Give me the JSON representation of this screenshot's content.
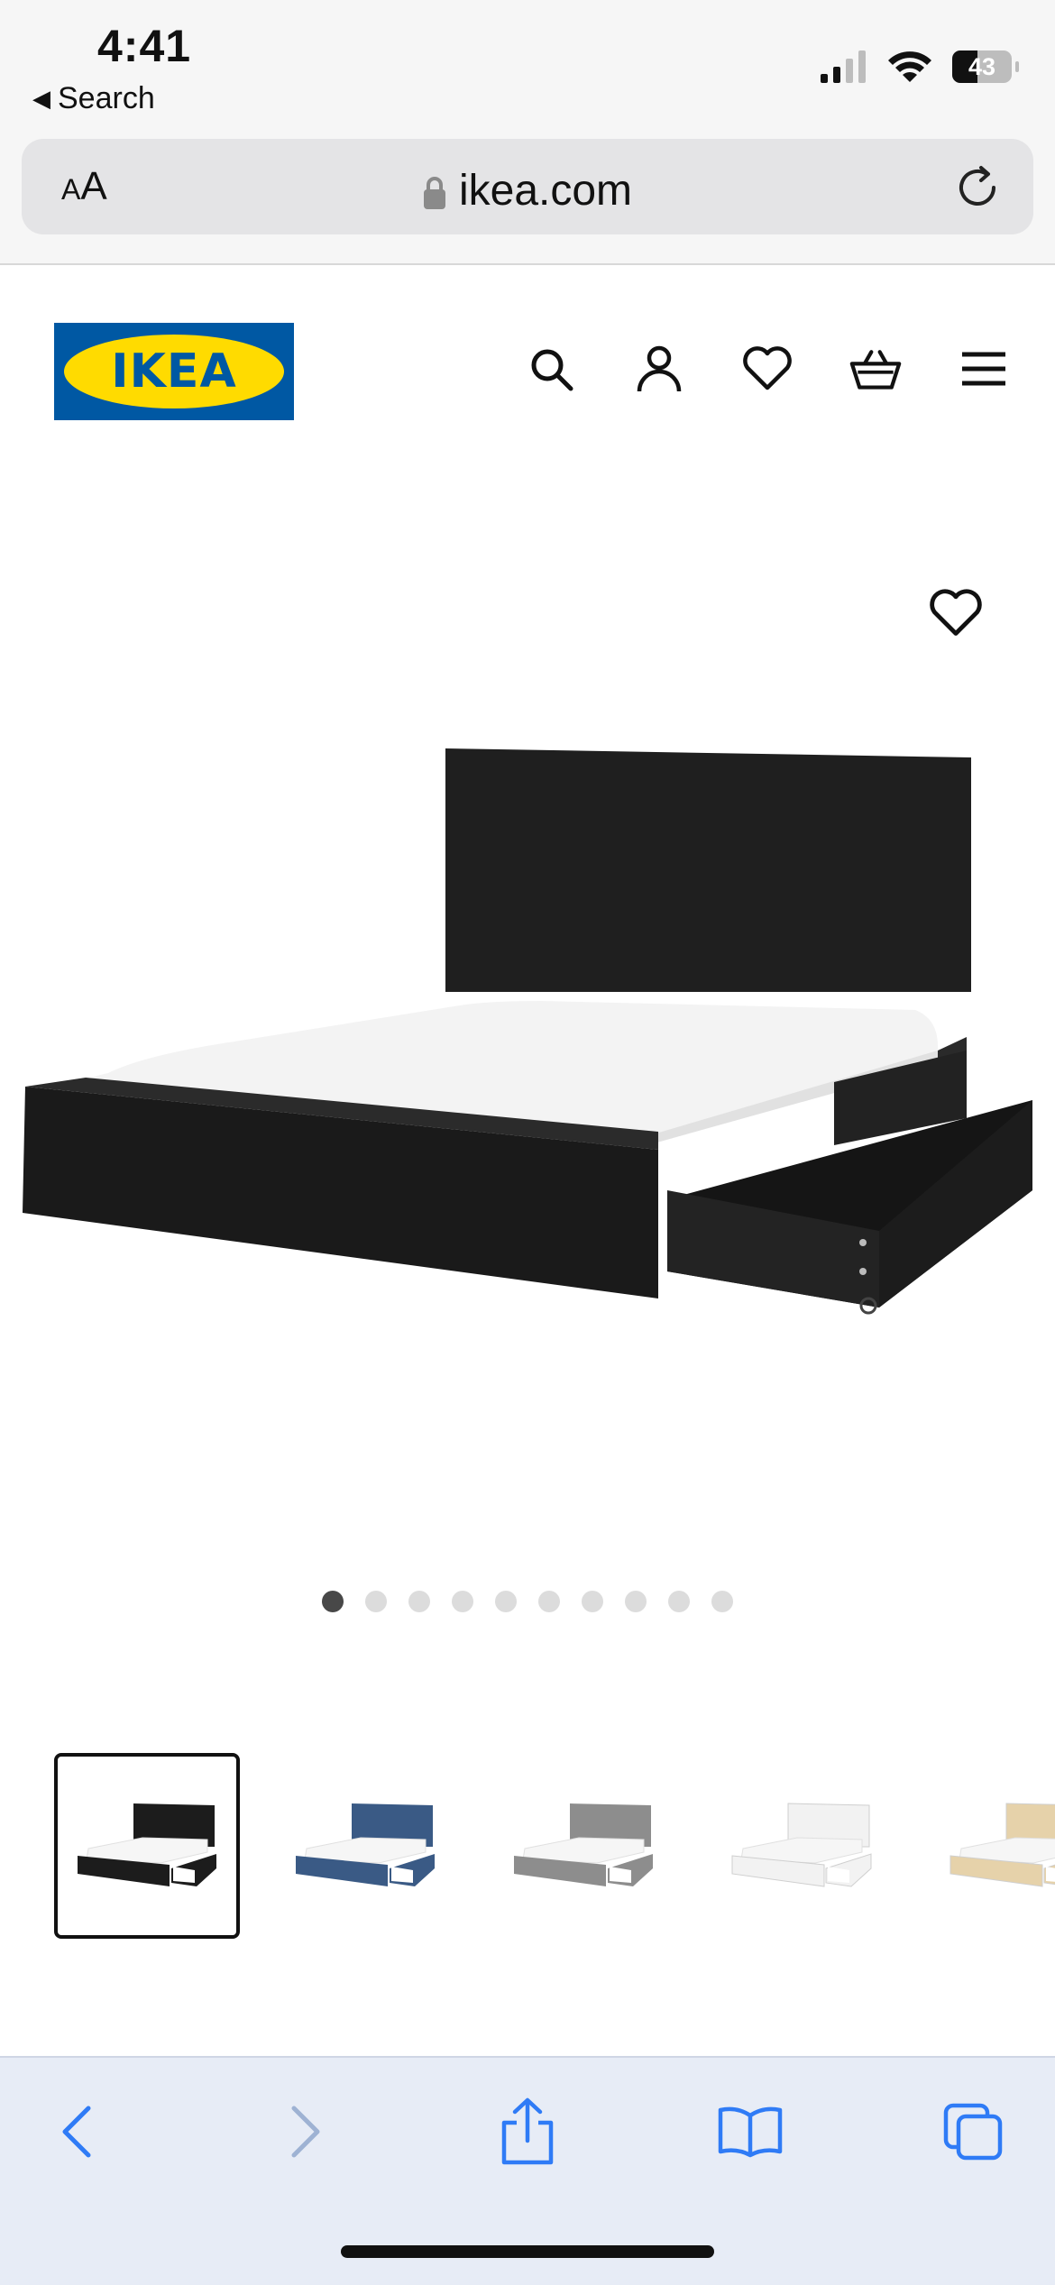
{
  "status_bar": {
    "time": "4:41",
    "back_app": "Search",
    "battery_level": "43",
    "battery_fraction": 0.43
  },
  "browser": {
    "text_size_small": "A",
    "text_size_large": "A",
    "url": "ikea.com",
    "icons": [
      "lock-icon",
      "reload-icon"
    ]
  },
  "header": {
    "logo_text": "IKEA",
    "icons": [
      "search-icon",
      "account-icon",
      "heart-icon",
      "basket-icon",
      "menu-icon"
    ]
  },
  "product": {
    "image": "black bed frame with two open storage drawers and white mattress",
    "gallery_count": 10,
    "active_index": 0,
    "thumbnails": [
      {
        "color": "black-brown",
        "hex": "#1c1c1c"
      },
      {
        "color": "blue",
        "hex": "#3a5a85"
      },
      {
        "color": "gray",
        "hex": "#8d8d8d"
      },
      {
        "color": "white",
        "hex": "#f2f2f2"
      },
      {
        "color": "oak veneer",
        "hex": "#e6d2aa"
      }
    ]
  },
  "toolbar": {
    "icons": [
      "back-icon",
      "forward-icon",
      "share-icon",
      "bookmarks-icon",
      "tabs-icon"
    ],
    "accent": "#2f7bf6"
  }
}
